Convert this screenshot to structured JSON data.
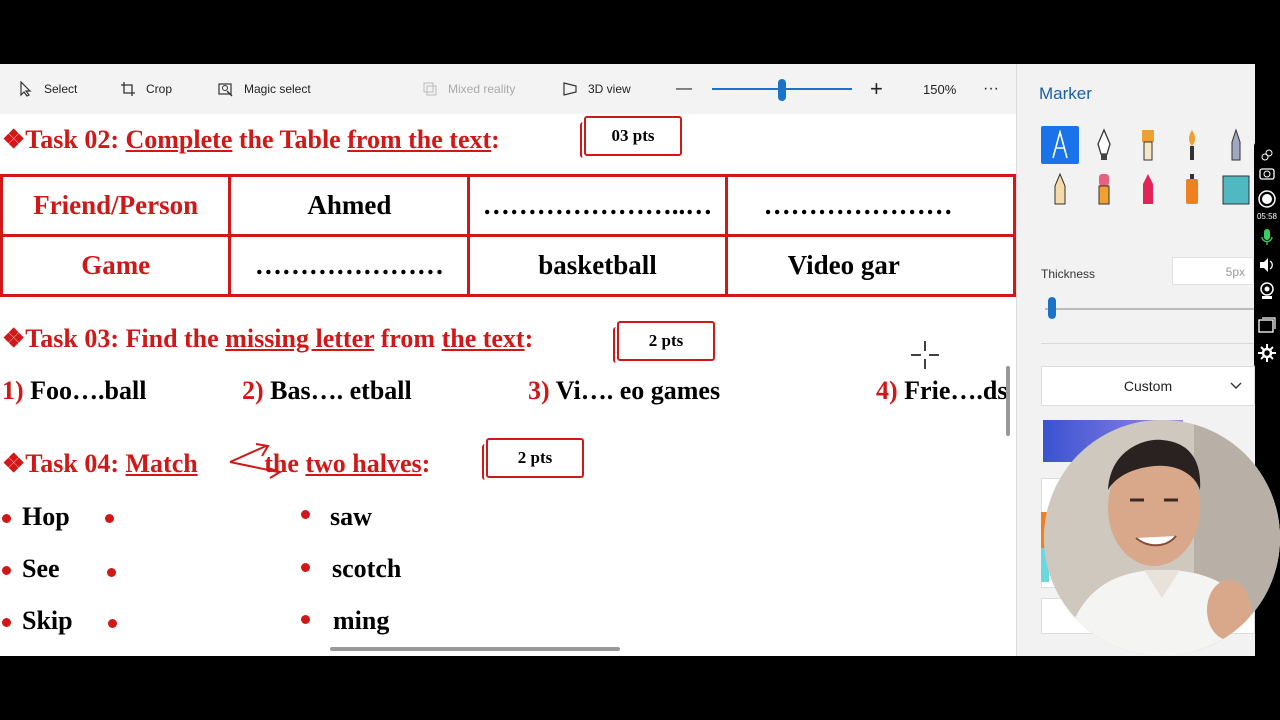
{
  "toolbar": {
    "select_label": "Select",
    "crop_label": "Crop",
    "magic_select_label": "Magic select",
    "mixed_reality_label": "Mixed reality",
    "view3d_label": "3D view",
    "zoom_minus": "—",
    "zoom_plus": "+",
    "zoom_percent": "150%",
    "zoom_level": 0.5,
    "more_label": "···"
  },
  "document": {
    "task02": {
      "prefix": "❖Task 02: ",
      "w1": "Complete",
      "w2": " the Table ",
      "w3": "from the text",
      "w4": ":",
      "pts": "03 pts"
    },
    "table": {
      "rows": [
        [
          "Friend/Person",
          "Ahmed",
          "…………………..…",
          "…………………"
        ],
        [
          "Game",
          "…………………",
          "basketball",
          "Video gar"
        ]
      ]
    },
    "task03": {
      "prefix": "❖Task 03: Find the ",
      "w1": "missing letter",
      "w2": " from ",
      "w3": "the text",
      "w4": ":",
      "pts": "2 pts"
    },
    "questions": [
      {
        "num": "1)",
        "text": " Foo….ball"
      },
      {
        "num": "2)",
        "text": " Bas…. etball"
      },
      {
        "num": "3)",
        "text": " Vi…. eo games"
      },
      {
        "num": "4)",
        "text": " Frie….ds"
      }
    ],
    "task04": {
      "prefix": "❖Task 04: ",
      "w1": "Match",
      "w2": " the ",
      "w3": "two halves",
      "w4": ":",
      "pts": "2 pts"
    },
    "left_words": [
      "Hop",
      "See",
      "Skip"
    ],
    "right_words": [
      "saw",
      "scotch",
      "ming"
    ]
  },
  "panel": {
    "title": "Marker",
    "thickness_label": "Thickness",
    "thickness_value": "5px",
    "color_mode": "Custom"
  },
  "capture": {
    "time": "05:58"
  },
  "colors": {
    "accent": "#1a73e8",
    "doc_red": "#d01818"
  }
}
